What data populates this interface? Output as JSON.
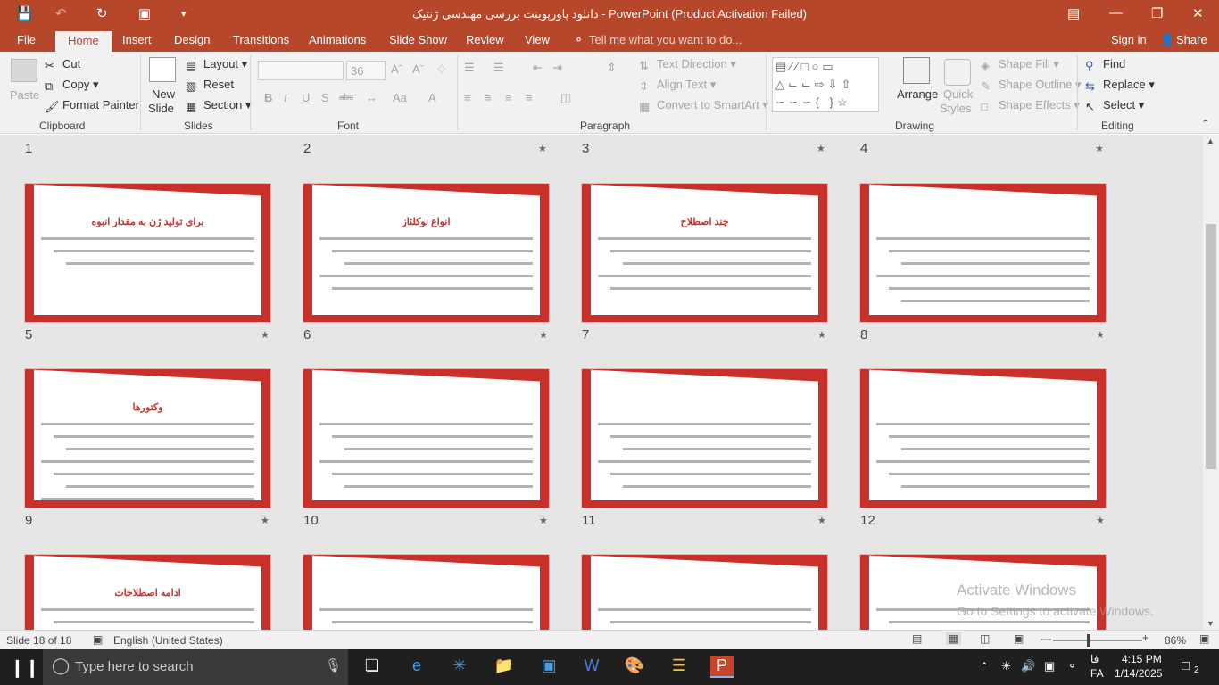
{
  "app": {
    "title": "دانلود پاورپوینت بررسی مهندسی ژنتیک - PowerPoint (Product Activation Failed)"
  },
  "tabs": {
    "file": "File",
    "home": "Home",
    "insert": "Insert",
    "design": "Design",
    "transitions": "Transitions",
    "animations": "Animations",
    "slide_show": "Slide Show",
    "review": "Review",
    "view": "View",
    "tell_me": "Tell me what you want to do...",
    "sign_in": "Sign in",
    "share": "Share"
  },
  "ribbon": {
    "clipboard": {
      "paste": "Paste",
      "cut": "Cut",
      "copy": "Copy",
      "format_painter": "Format Painter",
      "label": "Clipboard"
    },
    "slides": {
      "new_slide_1": "New",
      "new_slide_2": "Slide",
      "layout": "Layout",
      "reset": "Reset",
      "section": "Section",
      "label": "Slides"
    },
    "font": {
      "size": "36",
      "label": "Font",
      "bold": "B",
      "italic": "I",
      "underline": "U",
      "strike": "S",
      "shadow": "abc"
    },
    "paragraph": {
      "text_direction": "Text Direction",
      "align_text": "Align Text",
      "convert_smartart": "Convert to SmartArt",
      "label": "Paragraph"
    },
    "drawing": {
      "arrange": "Arrange",
      "quick_styles_1": "Quick",
      "quick_styles_2": "Styles",
      "shape_fill": "Shape Fill",
      "shape_outline": "Shape Outline",
      "shape_effects": "Shape Effects",
      "label": "Drawing"
    },
    "editing": {
      "find": "Find",
      "replace": "Replace",
      "select": "Select",
      "label": "Editing"
    }
  },
  "slides_row0": {
    "n1": "1",
    "n2": "2",
    "n3": "3",
    "n4": "4"
  },
  "slides": [
    {
      "num": "5",
      "title": "برای تولید ژن به مقدار انبوه"
    },
    {
      "num": "6",
      "title": "انواع نوکلئاز"
    },
    {
      "num": "7",
      "title": "چند اصطلاح"
    },
    {
      "num": "8",
      "title": ""
    },
    {
      "num": "9",
      "title": "وکتورها"
    },
    {
      "num": "10",
      "title": ""
    },
    {
      "num": "11",
      "title": ""
    },
    {
      "num": "12",
      "title": ""
    },
    {
      "num": "",
      "title": "ادامه اصطلاحات"
    },
    {
      "num": "",
      "title": ""
    },
    {
      "num": "",
      "title": ""
    },
    {
      "num": "",
      "title": ""
    }
  ],
  "star": "★",
  "status": {
    "slide": "Slide 18 of 18",
    "language": "English (United States)",
    "zoom": "86%"
  },
  "watermark": {
    "line1": "Activate Windows",
    "line2": "Go to Settings to activate Windows."
  },
  "taskbar": {
    "search_placeholder": "Type here to search",
    "time": "4:15 PM",
    "date": "1/14/2025",
    "lang1": "فا",
    "lang2": "FA",
    "notifications": "2"
  }
}
